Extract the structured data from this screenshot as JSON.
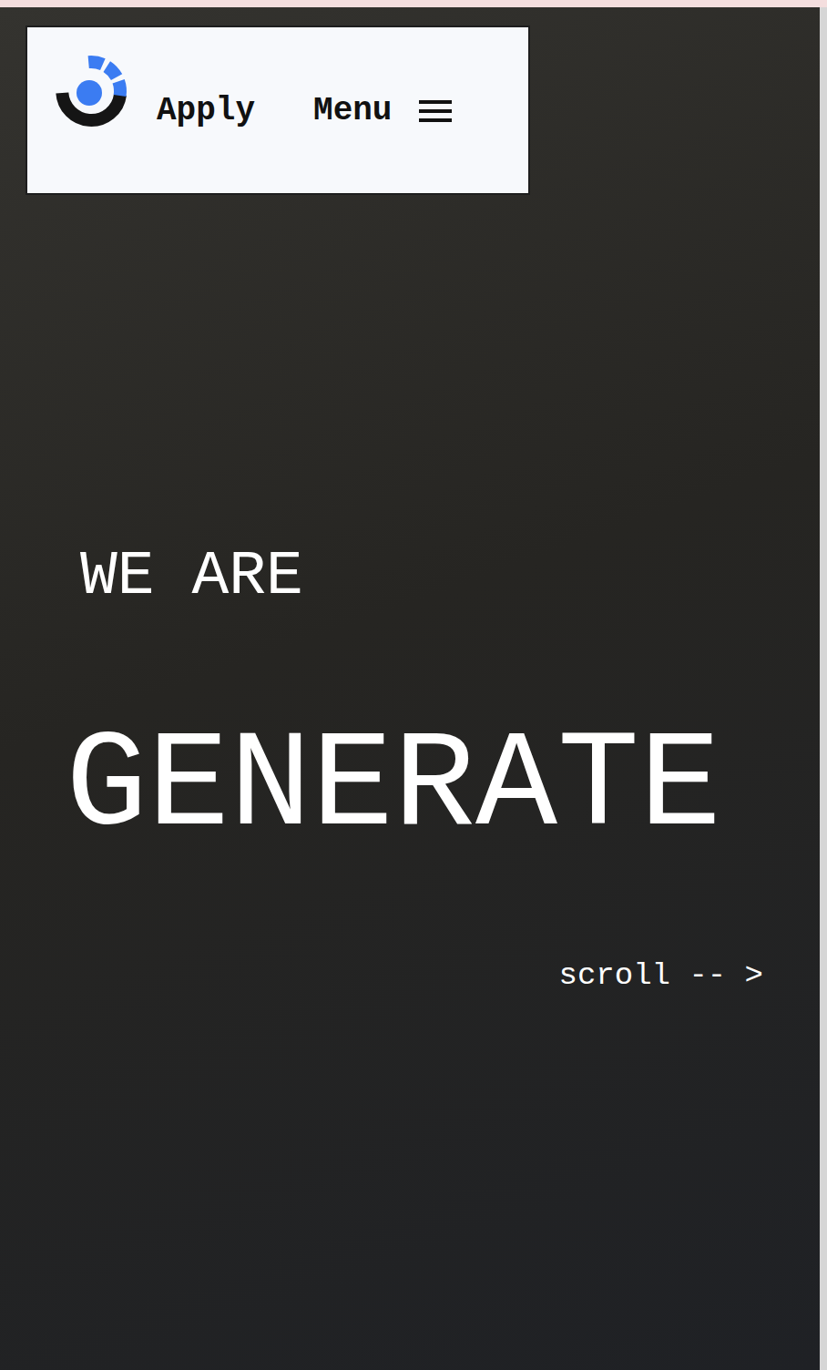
{
  "header": {
    "nav": [
      {
        "label": "Apply"
      },
      {
        "label": "Menu"
      }
    ]
  },
  "hero": {
    "lead": "WE ARE",
    "title": "GENERATE",
    "scroll": "scroll -- >"
  }
}
